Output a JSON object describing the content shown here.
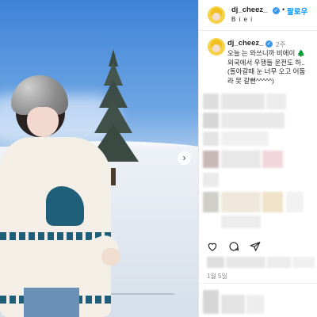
{
  "post": {
    "username": "dj_cheez_",
    "follow_label": "팔로우",
    "location": "B i e i",
    "time_ago": "2주",
    "caption": "오늘 는 와쓰니까 비에이 🌲\n외국에서 우행들 운전도 하..\n(돌아갈때 눈 너무 오고 어둡\n라 못 갈뻔^^^^^)",
    "date": "1월 5일"
  },
  "colors": {
    "verified": "#3897f0",
    "follow": "#0095f6",
    "sky": "#3d83d6"
  },
  "icons": {
    "like": "heart-icon",
    "comment": "comment-icon",
    "share": "paper-plane-icon",
    "next": "chevron-right-icon"
  }
}
